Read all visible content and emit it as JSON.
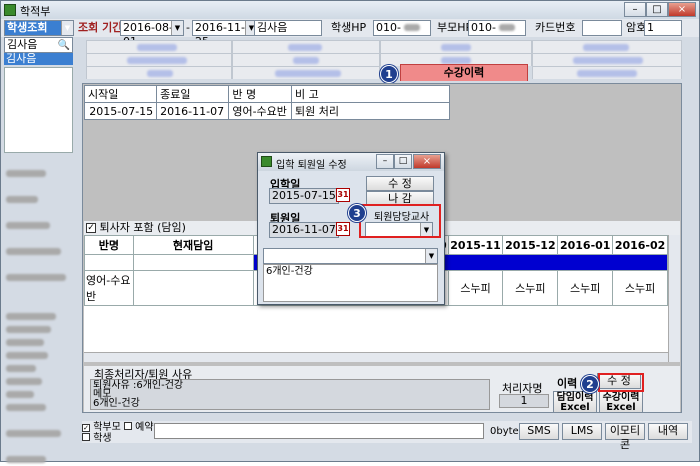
{
  "window": {
    "title": "학적부",
    "controls": [
      "–",
      "□",
      "×"
    ]
  },
  "toolbar": {
    "category_select": "학생조회",
    "period_label": "조회 기간",
    "date_from": "2016-08-01",
    "date_to": "2016-11-25",
    "student_name": "김사음",
    "student_hp_label": "학생HP",
    "student_hp_value": "010-",
    "parent_hp_label": "부모HP",
    "parent_hp_value": "010-",
    "card_label": "카드번호",
    "card_value": "",
    "password_label": "암호",
    "password_value": "1"
  },
  "left": {
    "search_value": "김사음",
    "list": [
      "김사음"
    ]
  },
  "tabs": {
    "active": "수강이력"
  },
  "history": {
    "headers": [
      "시작일",
      "종료일",
      "반 명",
      "비 고"
    ],
    "rows": [
      [
        "2015-07-15",
        "2016-11-07",
        "영어-수요반",
        "퇴원 처리"
      ]
    ]
  },
  "include_checkbox": "퇴사자 포함 (담임)",
  "grid": {
    "headers": [
      "반명",
      "현재담임",
      "0",
      "2015-11",
      "2015-12",
      "2016-01",
      "2016-02"
    ],
    "row": [
      "영어-수요반",
      "",
      "",
      "스누피",
      "스누피",
      "스누피",
      "스누피"
    ]
  },
  "dialog": {
    "title": "입학 퇴원일 수정",
    "entry_label": "입학일",
    "entry_date": "2015-07-15",
    "exit_label": "퇴원일",
    "exit_date": "2016-11-07",
    "edit_btn": "수  정",
    "exit_btn": "나  감",
    "teacher_label": "퇴원담당교사",
    "teacher_value": "",
    "reason_value": "6개인-건강"
  },
  "reason": {
    "section_label": "최종처리자/퇴원 사유",
    "lines": [
      "퇴원사유 :6개인-건강",
      "메모",
      "6개인-건강"
    ],
    "handler_label": "처리자명",
    "handler_value": "1"
  },
  "actions": {
    "history_label": "이력",
    "edit_btn": "수  정",
    "teacher_history": "담임이력",
    "course_history": "수강이력",
    "excel": "Excel"
  },
  "bottom": {
    "parent_chk": "학부모",
    "student_chk": "학생",
    "reserve_chk": "예약",
    "bytes": "0byte",
    "sms": "SMS",
    "lms": "LMS",
    "emoticon": "이모티콘",
    "history": "내역"
  },
  "badges": [
    "1",
    "2",
    "3"
  ]
}
